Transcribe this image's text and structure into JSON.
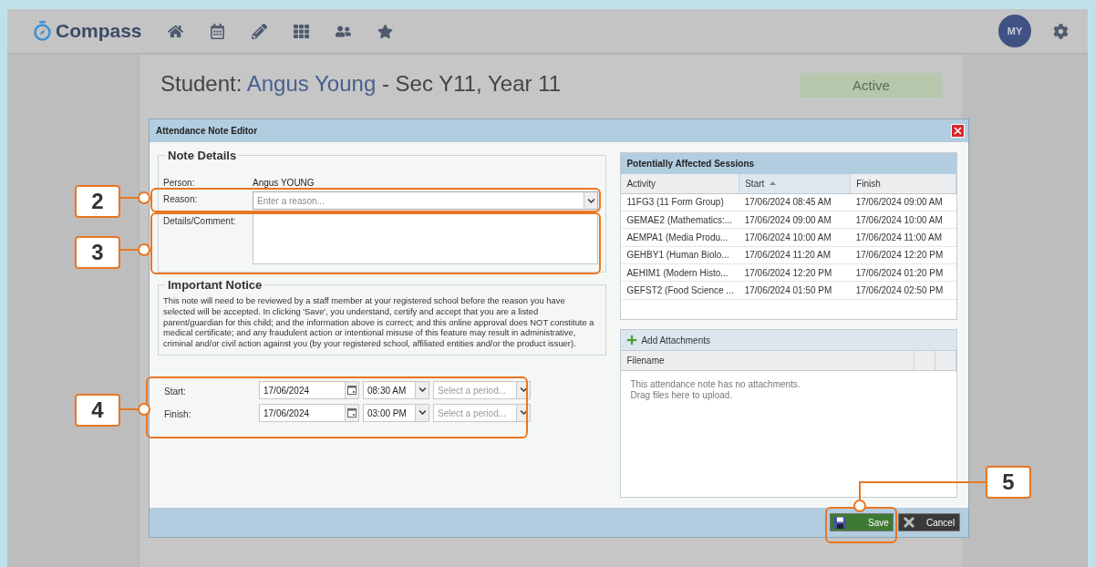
{
  "app": {
    "logo": "Compass",
    "avatar_initials": "MY"
  },
  "page": {
    "title_prefix": "Student: ",
    "student_name": "Angus Young",
    "title_suffix": " - Sec Y11, Year 11",
    "status": "Active"
  },
  "dialog": {
    "title": "Attendance Note Editor",
    "note_details": {
      "legend": "Note Details",
      "person_label": "Person:",
      "person": "Angus YOUNG",
      "reason_label": "Reason:",
      "reason_placeholder": "Enter a reason...",
      "details_label": "Details/Comment:"
    },
    "notice": {
      "legend": "Important Notice",
      "text": "This note will need to be reviewed by a staff member at your registered school before the reason you have selected will be accepted. In clicking 'Save', you understand, certify and accept that you are a listed parent/guardian for this child; and the information above is correct; and this online approval does NOT constitute a medical certificate; and any fraudulent action or intentional misuse of this feature may result in administrative, criminal and/or civil action against you (by your registered school, affiliated entities and/or the product issuer)."
    },
    "times": [
      {
        "label": "Start:",
        "date": "17/06/2024",
        "time": "08:30 AM",
        "period_placeholder": "Select a period..."
      },
      {
        "label": "Finish:",
        "date": "17/06/2024",
        "time": "03:00 PM",
        "period_placeholder": "Select a period..."
      }
    ],
    "sessions": {
      "title": "Potentially Affected Sessions",
      "columns": [
        {
          "label": "Activity",
          "sorted": false
        },
        {
          "label": "Start",
          "sorted": true
        },
        {
          "label": "Finish",
          "sorted": false
        }
      ],
      "rows": [
        [
          "11FG3 (11 Form Group)",
          "17/06/2024 08:45 AM",
          "17/06/2024 09:00 AM"
        ],
        [
          "GEMAE2 (Mathematics:...",
          "17/06/2024 09:00 AM",
          "17/06/2024 10:00 AM"
        ],
        [
          "AEMPA1 (Media Produ...",
          "17/06/2024 10:00 AM",
          "17/06/2024 11:00 AM"
        ],
        [
          "GEHBY1 (Human Biolo...",
          "17/06/2024 11:20 AM",
          "17/06/2024 12:20 PM"
        ],
        [
          "AEHIM1 (Modern Histo...",
          "17/06/2024 12:20 PM",
          "17/06/2024 01:20 PM"
        ],
        [
          "GEFST2 (Food Science ...",
          "17/06/2024 01:50 PM",
          "17/06/2024 02:50 PM"
        ]
      ]
    },
    "attachments": {
      "button": "Add Attachments",
      "columns": [
        "Filename"
      ],
      "empty_lines": [
        "This attendance note has no attachments.",
        "Drag files here to upload."
      ]
    },
    "buttons": [
      {
        "kind": "save",
        "label": "Save"
      },
      {
        "kind": "cancel",
        "label": "Cancel"
      }
    ]
  },
  "callouts": [
    {
      "number": "2"
    },
    {
      "number": "3"
    },
    {
      "number": "4"
    },
    {
      "number": "5"
    }
  ]
}
